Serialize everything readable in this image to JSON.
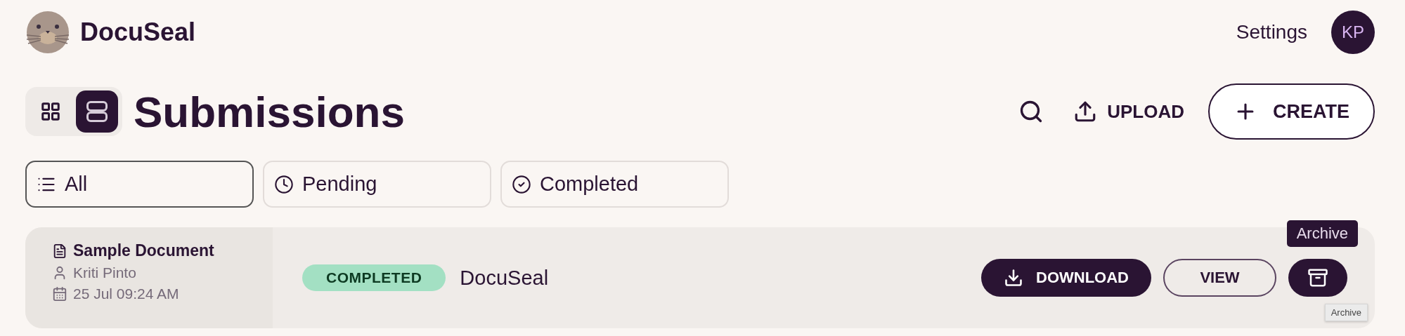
{
  "header": {
    "brand": "DocuSeal",
    "settings": "Settings",
    "avatar": "KP"
  },
  "title": "Submissions",
  "view_toggle": [
    {
      "kind": "grid",
      "selected": false
    },
    {
      "kind": "list",
      "selected": true
    }
  ],
  "actions": {
    "upload": "UPLOAD",
    "create": "CREATE"
  },
  "filters": [
    {
      "kind": "all",
      "label": "All",
      "selected": true
    },
    {
      "kind": "pending",
      "label": "Pending",
      "selected": false
    },
    {
      "kind": "completed",
      "label": "Completed",
      "selected": false
    }
  ],
  "submissions": [
    {
      "template": "Sample Document",
      "submitter": "Kriti Pinto",
      "date": "25 Jul 09:24 AM",
      "status": "COMPLETED",
      "name": "DocuSeal",
      "download": "DOWNLOAD",
      "view": "VIEW",
      "archive_tooltip": "Archive",
      "native_tooltip": "Archive"
    }
  ]
}
